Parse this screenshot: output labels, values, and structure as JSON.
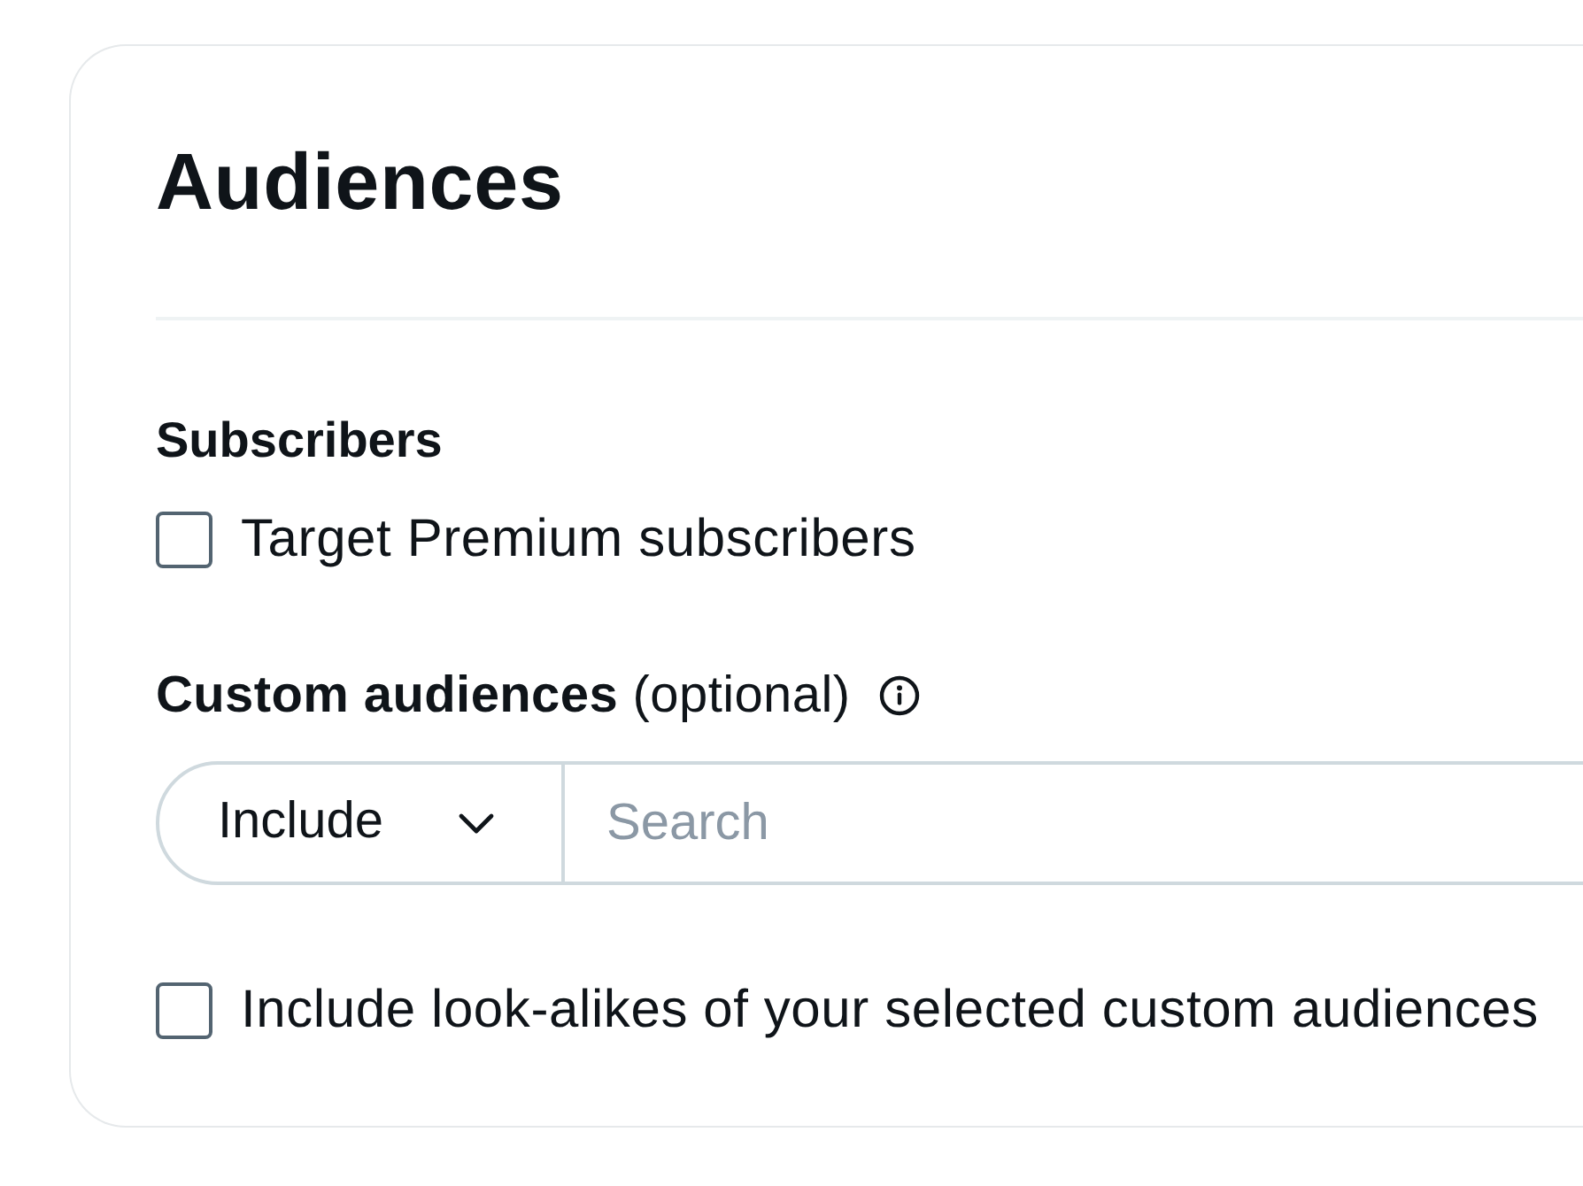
{
  "card": {
    "title": "Audiences"
  },
  "subscribers": {
    "heading": "Subscribers",
    "checkbox": {
      "label": "Target Premium subscribers",
      "checked": false
    }
  },
  "custom_audiences": {
    "label": "**Custom audiences** (optional)",
    "select": {
      "value": "Include"
    },
    "search": {
      "placeholder": "Search"
    },
    "lookalikes": {
      "label": "Include look-alikes of your selected custom audiences",
      "checked": false
    }
  }
}
